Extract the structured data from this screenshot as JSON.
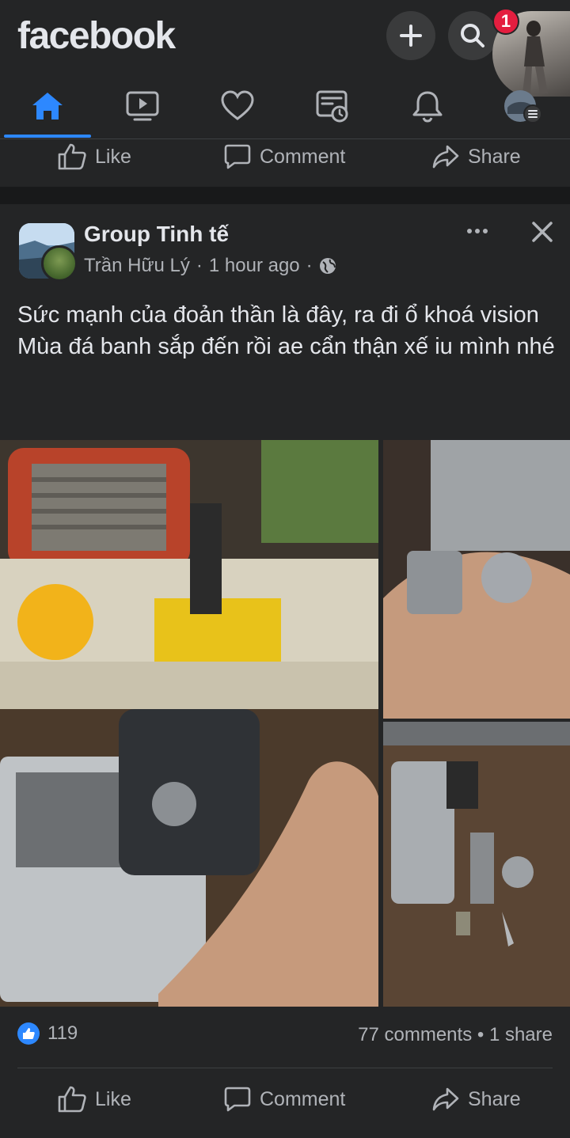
{
  "app": {
    "logo": "facebook"
  },
  "header": {
    "notification_count": "1"
  },
  "tabs": [
    {
      "name": "home",
      "icon": "home-icon",
      "active": true
    },
    {
      "name": "watch",
      "icon": "video-icon"
    },
    {
      "name": "dating",
      "icon": "heart-icon"
    },
    {
      "name": "memories",
      "icon": "memories-icon"
    },
    {
      "name": "notifications",
      "icon": "bell-icon"
    },
    {
      "name": "menu",
      "icon": "menu-icon"
    }
  ],
  "actions": {
    "like": "Like",
    "comment": "Comment",
    "share": "Share"
  },
  "post": {
    "group_name": "Group Tinh tế",
    "author": "Trần Hữu Lý",
    "time": "1 hour ago",
    "separator": "·",
    "text_line1": "Sức mạnh của đoản thần là đây, ra đi ổ khoá vision",
    "text_line2": "Mùa đá banh sắp đến rồi ae cẩn thận xế iu mình nhé",
    "like_count": "119",
    "comments_shares": "77 comments • 1 share"
  },
  "colors": {
    "accent": "#2d88ff",
    "background": "#18191a",
    "surface": "#242526",
    "badge": "#e41e3f"
  }
}
